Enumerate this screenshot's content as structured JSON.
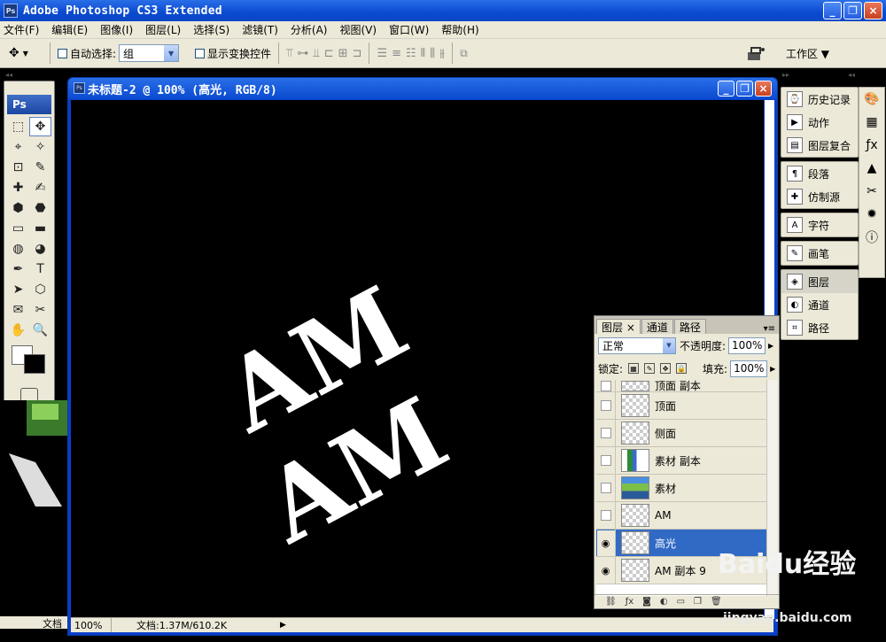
{
  "app": {
    "title": "Adobe Photoshop CS3 Extended",
    "icon_label": "Ps"
  },
  "window_buttons": [
    "_",
    "❐",
    "×"
  ],
  "menu": [
    "文件(F)",
    "编辑(E)",
    "图像(I)",
    "图层(L)",
    "选择(S)",
    "滤镜(T)",
    "分析(A)",
    "视图(V)",
    "窗口(W)",
    "帮助(H)"
  ],
  "options": {
    "auto_select_label": "自动选择:",
    "auto_select_value": "组",
    "show_transform_label": "显示变换控件",
    "workspace_label": "工作区 ▼"
  },
  "toolbox": {
    "header": "Ps",
    "tools": [
      "⬚",
      "✥",
      "⌖",
      "✧",
      "⊡",
      "✎",
      "✚",
      "✍",
      "⬢",
      "⬣",
      "▭",
      "▬",
      "◍",
      "◕",
      "✒",
      "T",
      "➤",
      "⬡",
      "✉",
      "✂",
      "✋",
      "🔍"
    ]
  },
  "document": {
    "title": "未标题-2 @ 100% (高光, RGB/8)",
    "canvas_text_1": "AM",
    "canvas_text_2": "AM",
    "zoom": "100%",
    "doc_info": "文档:1.37M/610.2K"
  },
  "right_dock": {
    "group1": [
      "历史记录",
      "动作",
      "图层复合"
    ],
    "group2": [
      "段落",
      "仿制源"
    ],
    "group3": [
      "字符"
    ],
    "group4": [
      "画笔"
    ],
    "group5": [
      "图层",
      "通道",
      "路径"
    ]
  },
  "layers_panel": {
    "tabs": [
      "图层 ×",
      "通道",
      "路径"
    ],
    "blend_mode": "正常",
    "opacity_label": "不透明度:",
    "opacity_value": "100%",
    "lock_label": "锁定:",
    "fill_label": "填充:",
    "fill_value": "100%",
    "layers": [
      {
        "name": "顶面 副本",
        "visible": false
      },
      {
        "name": "顶面",
        "visible": false
      },
      {
        "name": "侧面",
        "visible": false
      },
      {
        "name": "素材 副本",
        "visible": false
      },
      {
        "name": "素材",
        "visible": false
      },
      {
        "name": "AM",
        "visible": false
      },
      {
        "name": "高光",
        "visible": true
      },
      {
        "name": "AM 副本 9",
        "visible": true
      }
    ]
  },
  "taskbar": {
    "label": "文档"
  },
  "watermark": {
    "brand": "Baidu经验",
    "url": "jingyan.baidu.com"
  },
  "colors": {
    "xp_blue": "#0a4ad0",
    "selection": "#316ac5",
    "panel_bg": "#ece9d8"
  }
}
